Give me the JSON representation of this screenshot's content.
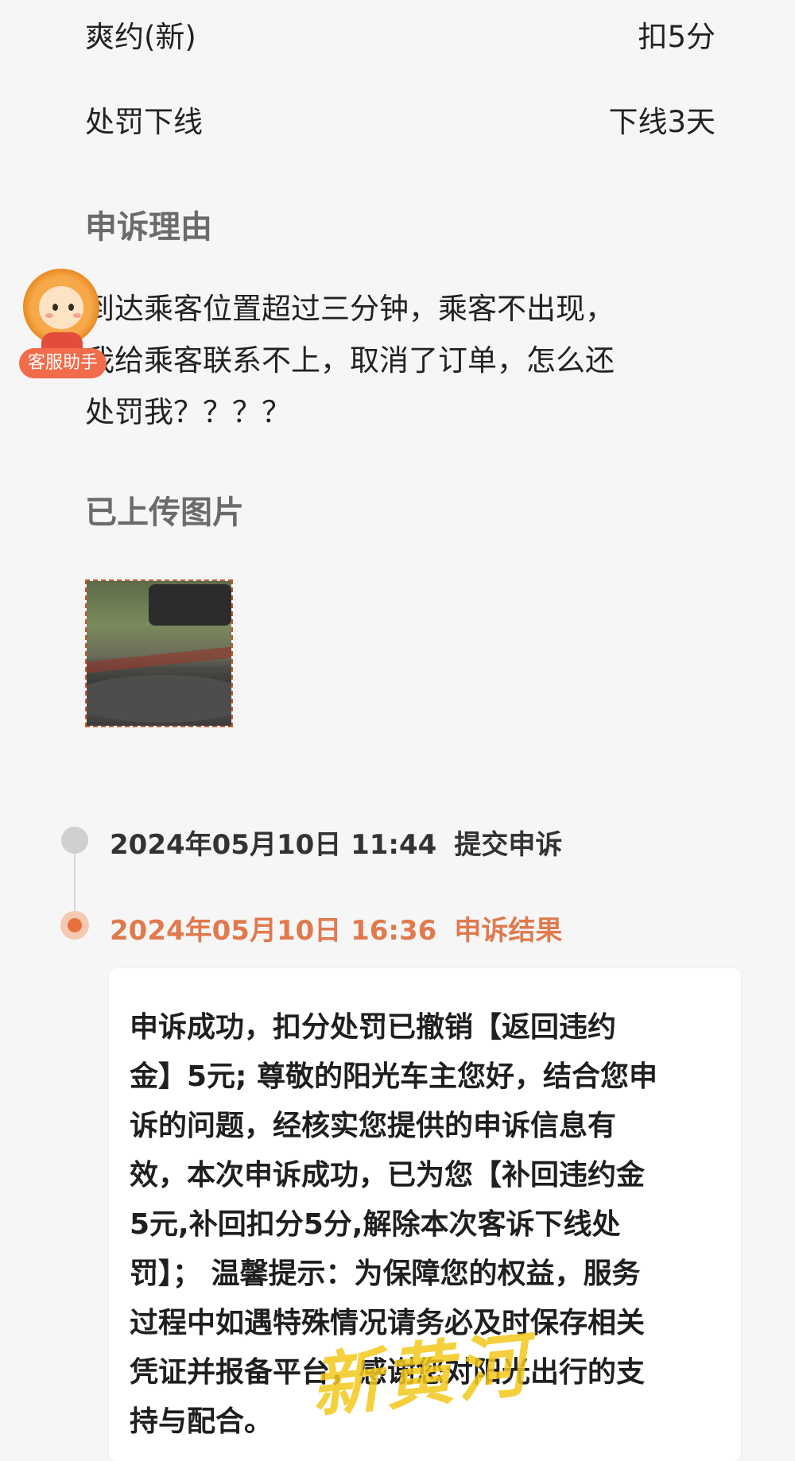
{
  "summary": {
    "rows": [
      {
        "label": "爽约(新)",
        "value": "扣5分"
      },
      {
        "label": "处罚下线",
        "value": "下线3天"
      }
    ]
  },
  "appeal_reason": {
    "title": "申诉理由",
    "text": "到达乘客位置超过三分钟，乘客不出现，\n我给乘客联系不上，取消了订单，怎么还\n处罚我？？？？"
  },
  "uploaded_images": {
    "title": "已上传图片"
  },
  "assistant": {
    "badge": "客服助手"
  },
  "timeline": {
    "events": [
      {
        "time": "2024年05月10日 11:44",
        "label": "提交申诉"
      },
      {
        "time": "2024年05月10日 16:36",
        "label": "申诉结果"
      }
    ],
    "result": "申诉成功，扣分处罚已撤销【返回违约\n金】5元; 尊敬的阳光车主您好，结合您申\n诉的问题，经核实您提供的申诉信息有\n效，本次申诉成功，已为您【补回违约金\n5元,补回扣分5分,解除本次客诉下线处\n罚】； 温馨提示：为保障您的权益，服务\n过程中如遇特殊情况请务必及时保存相关\n凭证并报备平台，感谢您对阳光出行的支\n持与配合。"
  },
  "watermark": {
    "text": "新黄河"
  },
  "colors": {
    "accent": "#e8703f",
    "background": "#f6f6f6",
    "muted_title": "#6b6b6b"
  }
}
